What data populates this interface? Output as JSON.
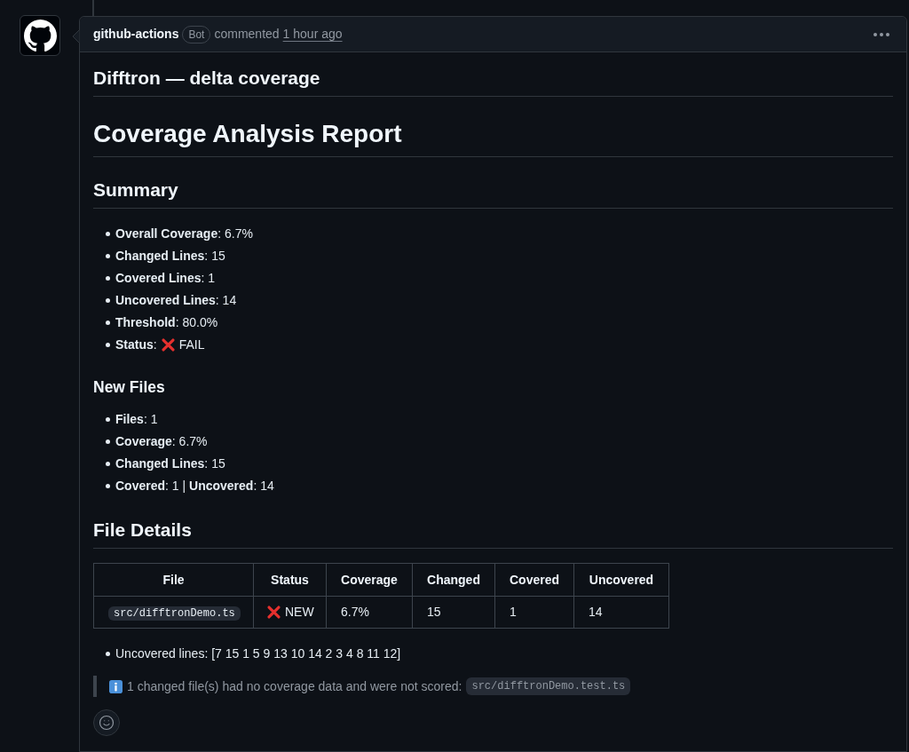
{
  "comment": {
    "author": "github-actions",
    "badge": "Bot",
    "action": "commented",
    "time": "1 hour ago"
  },
  "body": [
    {
      "kind": "heading2",
      "text": "Difftron — delta coverage"
    },
    {
      "kind": "heading1",
      "text": "Coverage Analysis Report"
    },
    {
      "kind": "heading2",
      "text": "Summary"
    },
    {
      "kind": "list",
      "items": [
        {
          "text": "**Overall Coverage**: 6.7%"
        },
        {
          "text": "**Changed Lines**: 15"
        },
        {
          "text": "**Covered Lines**: 1"
        },
        {
          "text": "**Uncovered Lines**: 14"
        },
        {
          "text": "**Threshold**: 80.0%"
        },
        {
          "text": "**Status**:",
          "failed": true,
          "value": "FAIL"
        }
      ]
    },
    {
      "kind": "heading3",
      "text": "New Files"
    },
    {
      "kind": "list",
      "items": [
        {
          "text": "**Files**: 1"
        },
        {
          "text": "**Coverage**: 6.7%"
        },
        {
          "text": "**Changed Lines**: 15"
        },
        {
          "text": "**Covered**: 1 | **Uncovered**: 14"
        }
      ]
    },
    {
      "kind": "heading2",
      "text": "File Details"
    },
    {
      "kind": "table",
      "columns": [
        "File",
        "Status",
        "Coverage",
        "Changed",
        "Covered",
        "Uncovered"
      ],
      "rows": [
        {
          "failed": true,
          "cells": [
            "src/difftronDemo.ts",
            "NEW",
            "6.7%",
            "15",
            "1",
            "14"
          ]
        }
      ]
    },
    {
      "kind": "list",
      "items": [
        {
          "text": "Uncovered lines: [7 15 1 5 9 13 10 14 2 3 4 8 11 12]"
        }
      ]
    },
    {
      "kind": "note",
      "text": "1 changed file(s) had no coverage data and were not scored:",
      "code": "src/difftronDemo.test.ts"
    }
  ]
}
